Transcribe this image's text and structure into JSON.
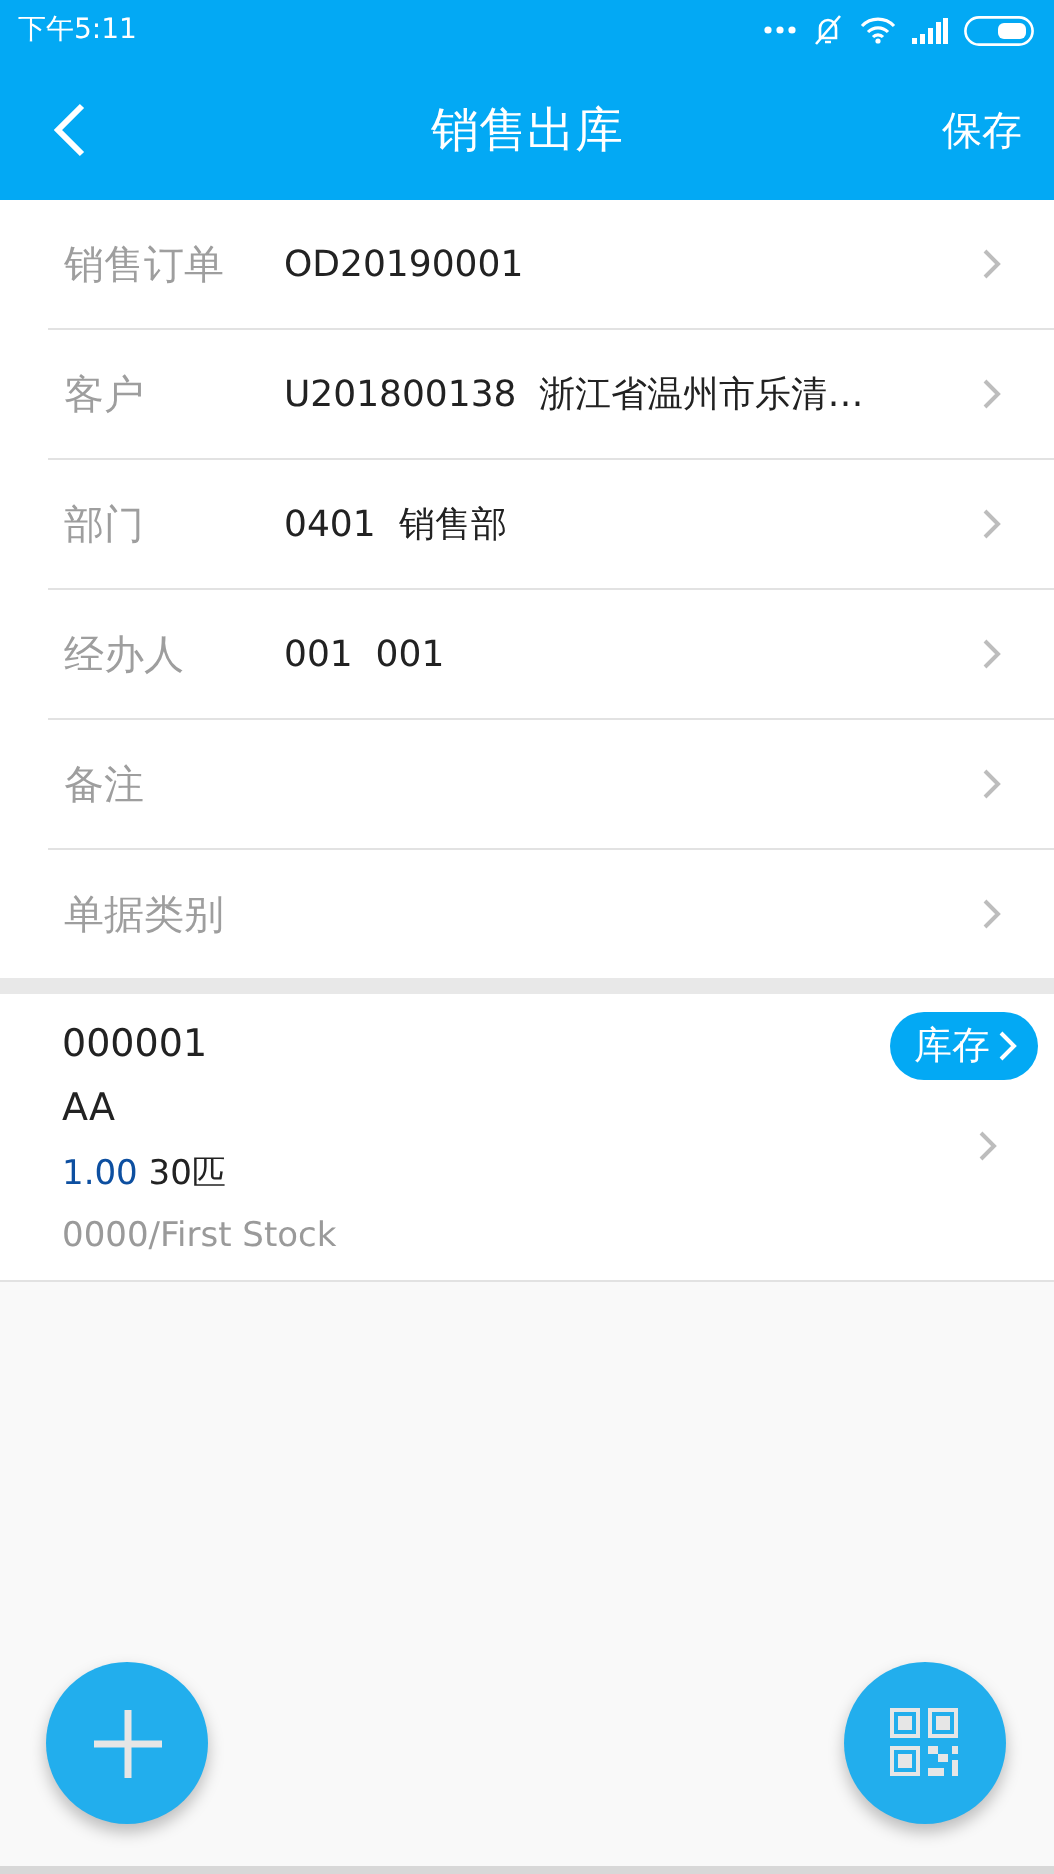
{
  "status_bar": {
    "time": "下午5:11"
  },
  "header": {
    "title": "销售出库",
    "action": "保存"
  },
  "form_rows": [
    {
      "label": "销售订单",
      "value": "OD20190001"
    },
    {
      "label": "客户",
      "value": "U201800138  浙江省温州市乐清…"
    },
    {
      "label": "部门",
      "value": "0401  销售部"
    },
    {
      "label": "经办人",
      "value": "001  001"
    },
    {
      "label": "备注"
    },
    {
      "label": "单据类别"
    }
  ],
  "items": [
    {
      "code": "000001",
      "name": "AA",
      "quantity": "1.00",
      "unit_qty": "30匹",
      "location": "0000/First Stock",
      "stock_button": "库存"
    }
  ]
}
